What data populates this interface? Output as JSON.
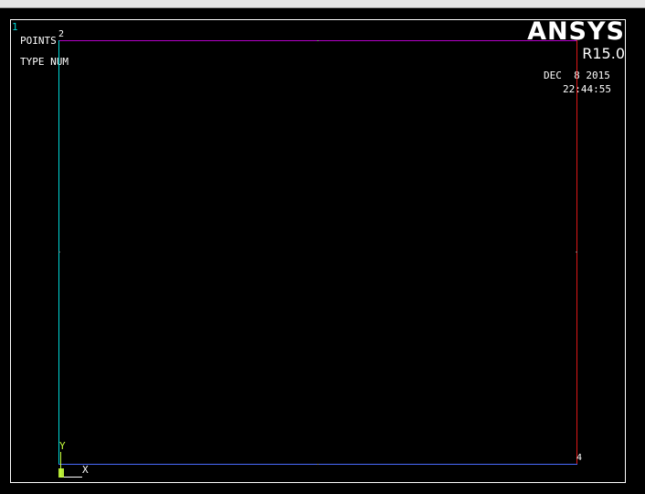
{
  "window": {
    "number": "1"
  },
  "plot_info": {
    "entity": "POINTS",
    "numbering": "TYPE NUM"
  },
  "logo": {
    "brand": "ANSYS",
    "release": "R15.0"
  },
  "timestamp": {
    "date": "DEC  8 2015",
    "time": "22:44:55"
  },
  "keypoints": {
    "top_left": "2",
    "bottom_right": "4"
  },
  "triad": {
    "x_label": "X",
    "y_label": "Y"
  },
  "colors": {
    "background": "#000000",
    "left_line": "#00d8d8",
    "top_line": "#b400c8",
    "right_line": "#e01818",
    "bottom_line": "#4a6cff",
    "triad": "#c8ff3c"
  }
}
